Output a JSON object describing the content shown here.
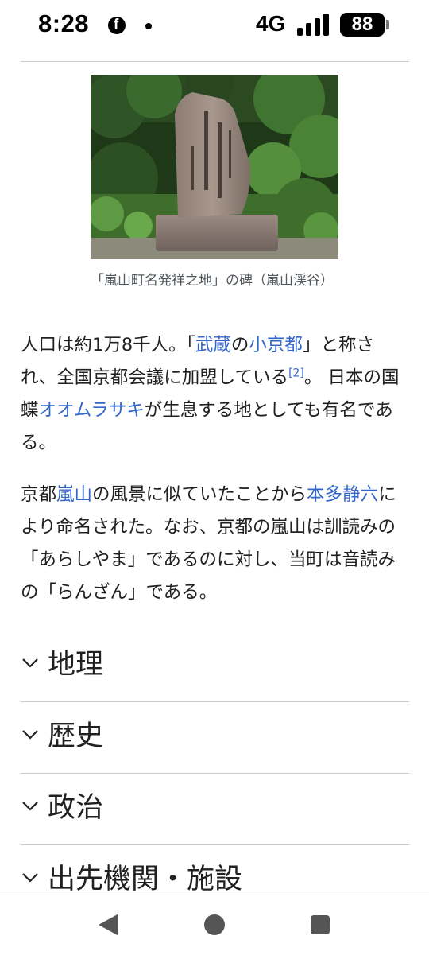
{
  "status_bar": {
    "time": "8:28",
    "app_icon": "facebook-icon",
    "network": "4G",
    "battery": "88"
  },
  "figure": {
    "image": "stone-monument-photo",
    "caption": "「嵐山町名発祥之地」の碑（嵐山渓谷）"
  },
  "paragraph1": {
    "t1": "人口は約1万8千人。「",
    "link_musashi": "武蔵",
    "t2": "の",
    "link_kokyoto": "小京都",
    "t3": "」と称され、全国京都会議に加盟している",
    "ref": "[2]",
    "t4": "。 日本の国蝶",
    "link_omurasaki": "オオムラサキ",
    "t5": "が生息する地としても有名である。"
  },
  "paragraph2": {
    "t1": "京都",
    "link_arashiyama": "嵐山",
    "t2": "の風景に似ていたことから",
    "link_honda": "本多静六",
    "t3": "により命名された。なお、京都の嵐山は訓読みの「あらしやま」であるのに対し、当町は音読みの「らんざん」である。"
  },
  "sections": [
    {
      "title": "地理"
    },
    {
      "title": "歴史"
    },
    {
      "title": "政治"
    },
    {
      "title": "出先機関・施設"
    }
  ],
  "nav": {
    "back_icon": "back-icon",
    "home_icon": "home-icon",
    "recents_icon": "recents-icon"
  },
  "colors": {
    "link": "#3366cc",
    "text": "#202122",
    "caption": "#54595d",
    "divider": "#c8ccd1"
  }
}
